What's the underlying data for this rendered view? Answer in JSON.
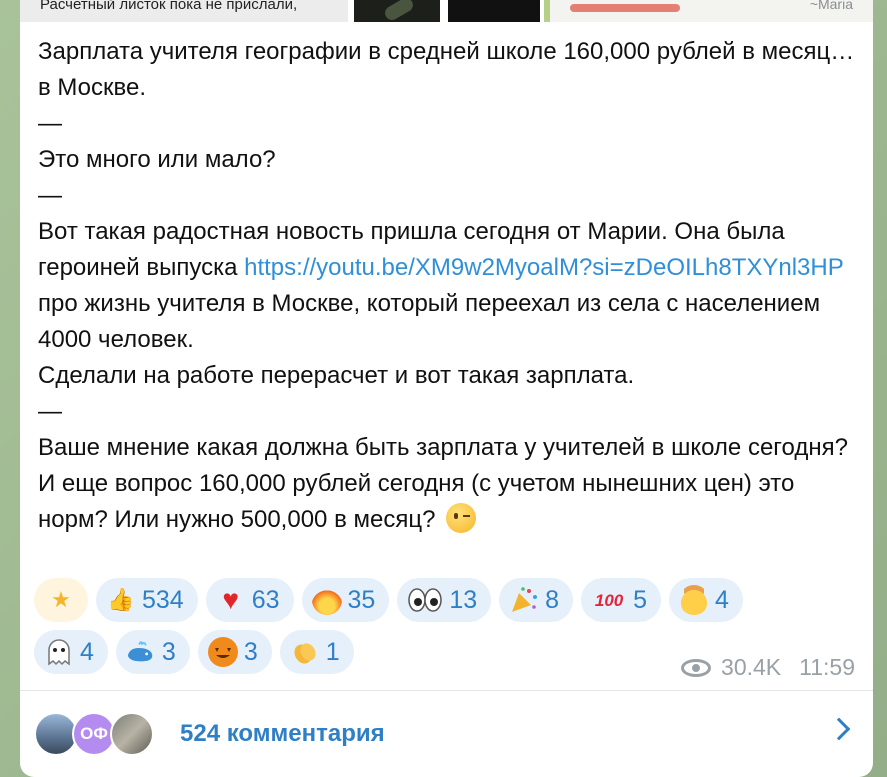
{
  "media": {
    "caption_left": "Расчетный листок пока не прислали,",
    "signature": "~Maria"
  },
  "post": {
    "line1": "Зарплата учителя географии в средней школе 160,000 рублей в месяц… в Москве.",
    "dash1": "—",
    "line2": "Это много или мало?",
    "dash2": "—",
    "line3_before_link": "Вот такая радостная новость пришла сегодня от Марии. Она была героиней выпуска ",
    "link": "https://youtu.be/XM9w2MyoalM?si=zDeOILh8TXYnl3HP",
    "line3_after_link": " про жизнь учителя в Москве, который переехал из села с населением 4000 человек.",
    "line4": "Сделали на работе перерасчет и вот такая зарплата.",
    "dash3": "—",
    "line5": "Ваше мнение какая должна быть зарплата у учителей в школе сегодня?",
    "line6": "И еще вопрос 160,000 рублей сегодня (с учетом нынешних цен) это норм? Или нужно 500,000 в месяц?"
  },
  "reactions": {
    "row1": [
      {
        "icon": "star",
        "count": ""
      },
      {
        "icon": "thumbs-up",
        "count": "534"
      },
      {
        "icon": "heart",
        "count": "63"
      },
      {
        "icon": "fire",
        "count": "35"
      },
      {
        "icon": "eyes",
        "count": "13"
      },
      {
        "icon": "party-popper",
        "count": "8"
      },
      {
        "icon": "hundred",
        "count": "5"
      },
      {
        "icon": "exploding-head",
        "count": "4"
      }
    ],
    "row2": [
      {
        "icon": "ghost",
        "count": "4"
      },
      {
        "icon": "whale",
        "count": "3"
      },
      {
        "icon": "jack-o-lantern",
        "count": "3"
      },
      {
        "icon": "clapping-hands",
        "count": "1"
      }
    ]
  },
  "meta": {
    "views": "30.4K",
    "time": "11:59"
  },
  "comments": {
    "avatar2_initials": "ОФ",
    "label": "524 комментария"
  },
  "colors": {
    "accent": "#2f7fc6",
    "link": "#2f8fd8",
    "chip_bg": "#e6f0fa"
  }
}
